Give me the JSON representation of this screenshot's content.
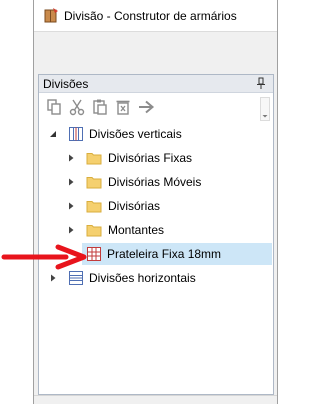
{
  "window": {
    "title": "Divisão - Construtor de armários",
    "app_icon": "wardrobe-builder-icon"
  },
  "panel": {
    "title": "Divisões",
    "pin_icon": "pin-icon",
    "toolbar": [
      {
        "name": "copy-icon",
        "state": "disabled"
      },
      {
        "name": "cut-icon",
        "state": "disabled"
      },
      {
        "name": "paste-icon",
        "state": "disabled"
      },
      {
        "name": "delete-icon",
        "state": "disabled"
      },
      {
        "name": "move-right-arrow-icon",
        "state": "disabled"
      }
    ]
  },
  "tree": {
    "root_vertical": {
      "label": "Divisões verticais",
      "expanded": true
    },
    "children": [
      {
        "label": "Divisórias Fixas",
        "icon": "folder-icon"
      },
      {
        "label": "Divisórias Móveis",
        "icon": "folder-icon"
      },
      {
        "label": "Divisórias",
        "icon": "folder-icon"
      },
      {
        "label": "Montantes",
        "icon": "folder-icon"
      }
    ],
    "selected_item": {
      "label": "Prateleira Fixa 18mm",
      "icon": "grid-shelf-icon"
    },
    "root_horizontal": {
      "label": "Divisões horizontais",
      "expanded": false
    }
  },
  "colors": {
    "selection": "#cde6f7",
    "folder": "#f5d06f",
    "annotation_arrow": "#e8141c"
  }
}
